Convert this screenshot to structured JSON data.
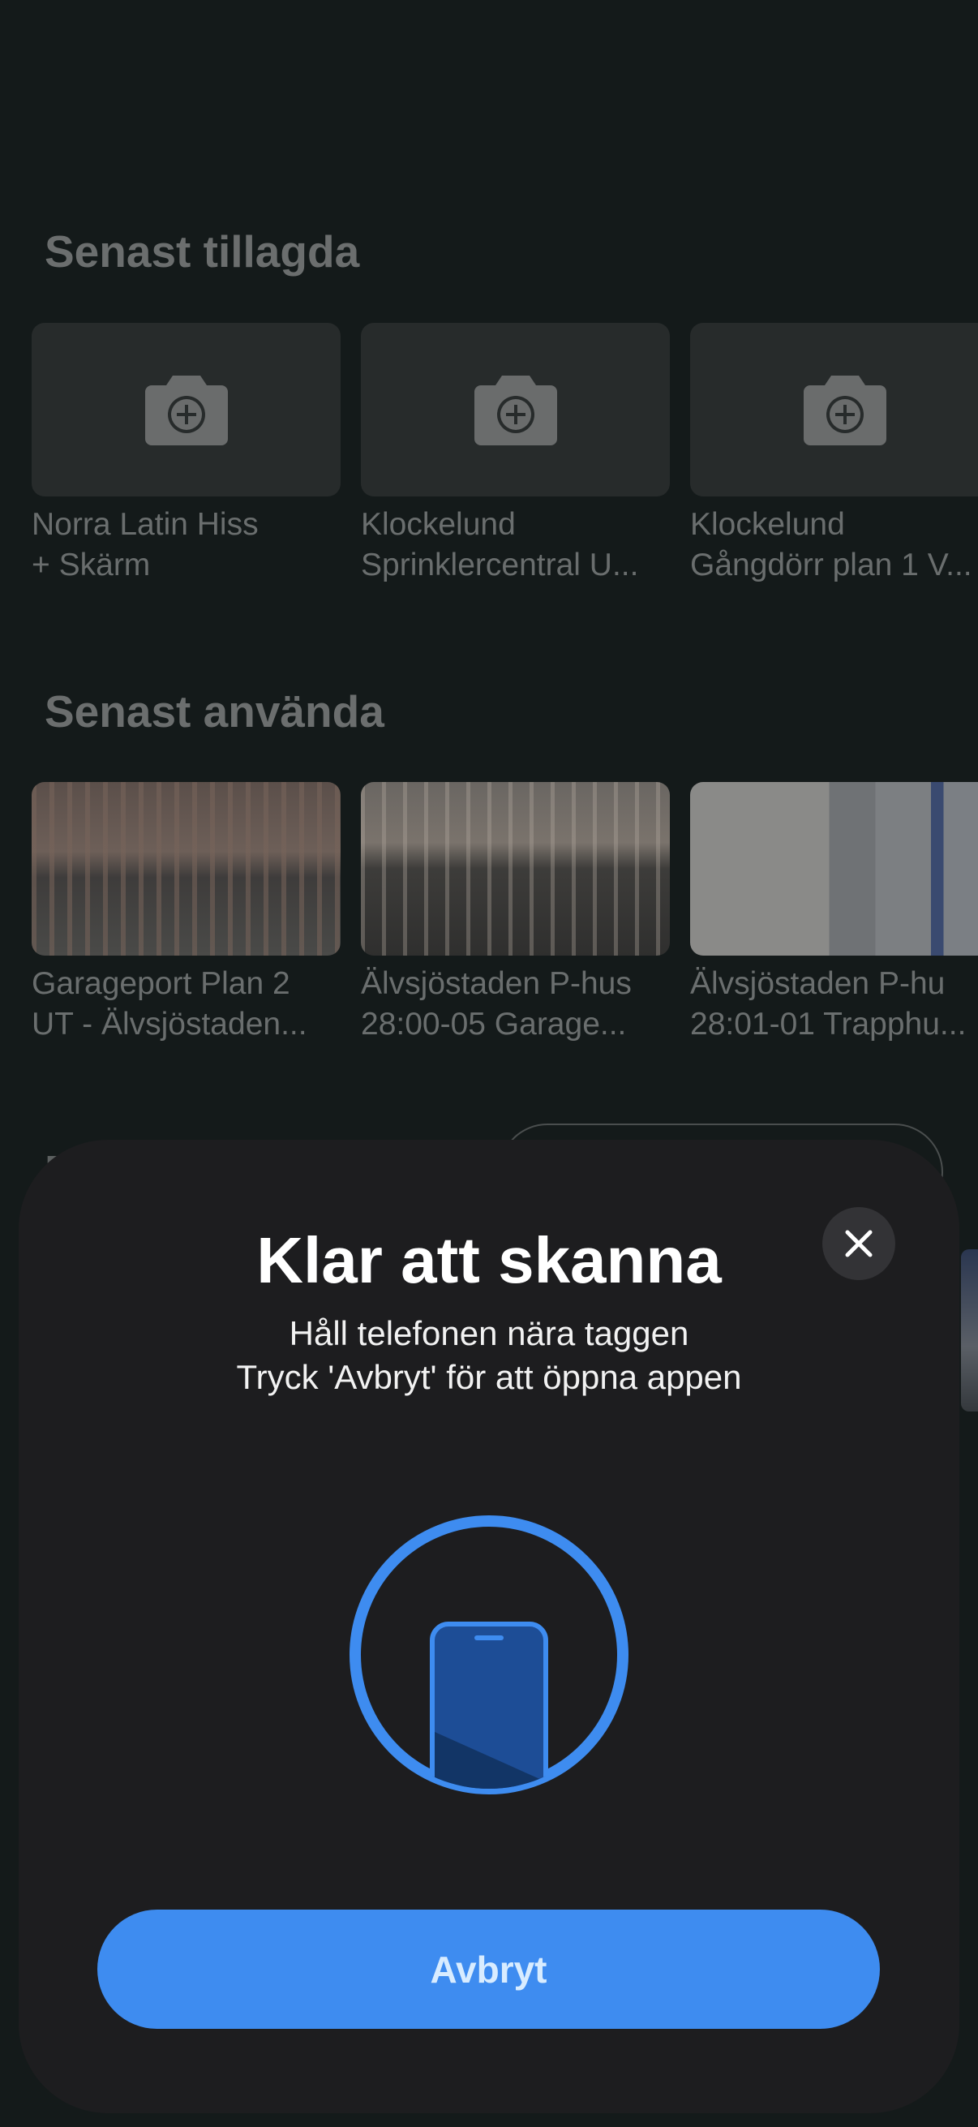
{
  "recently_added": {
    "title": "Senast tillagda",
    "items": [
      {
        "line1": "Norra Latin Hiss",
        "line2": "+ Skärm",
        "icon": "camera-add-icon"
      },
      {
        "line1": "Klockelund",
        "line2": "Sprinklercentral U...",
        "icon": "camera-add-icon"
      },
      {
        "line1": "Klockelund",
        "line2": "Gångdörr plan 1 V...",
        "icon": "camera-add-icon"
      }
    ]
  },
  "recently_used": {
    "title": "Senast använda",
    "items": [
      {
        "line1": "Garageport Plan 2",
        "line2": "UT - Älvsjöstaden..."
      },
      {
        "line1": "Älvsjöstaden P-hus",
        "line2": "28:00-05 Garage..."
      },
      {
        "line1": "Älvsjöstaden P-hu",
        "line2": "28:01-01 Trapphu..."
      }
    ]
  },
  "peek": {
    "letter": "F"
  },
  "scan_sheet": {
    "title": "Klar att skanna",
    "subtitle_line1": "Håll telefonen nära taggen",
    "subtitle_line2": "Tryck 'Avbryt' för att öppna appen",
    "cancel_label": "Avbryt",
    "accent_color": "#3e8cf0"
  }
}
